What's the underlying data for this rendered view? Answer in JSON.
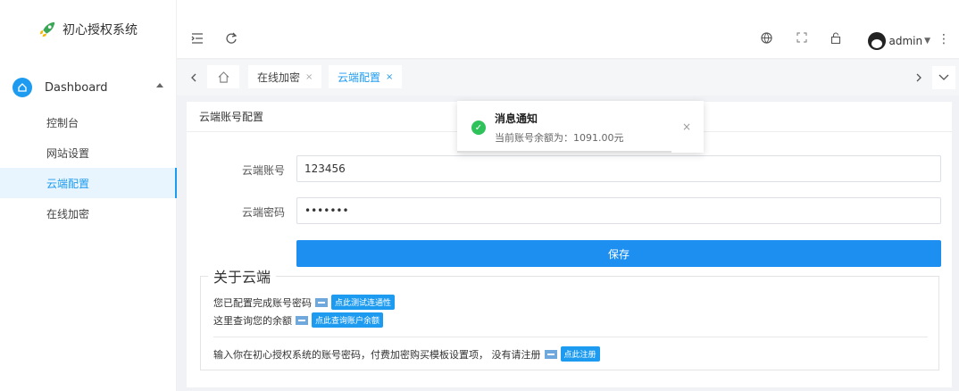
{
  "app": {
    "title": "初心授权系统"
  },
  "sidebar": {
    "parent": {
      "label": "Dashboard"
    },
    "items": [
      {
        "label": "控制台"
      },
      {
        "label": "网站设置"
      },
      {
        "label": "云端配置"
      },
      {
        "label": "在线加密"
      }
    ]
  },
  "header": {
    "username": "admin"
  },
  "tabs": [
    {
      "label": "在线加密",
      "close": "×"
    },
    {
      "label": "云端配置",
      "close": "×"
    }
  ],
  "card": {
    "title": "云端账号配置",
    "account_label": "云端账号",
    "account_value": "123456",
    "password_label": "云端密码",
    "password_value": "1234567",
    "save_label": "保存"
  },
  "about": {
    "legend": "关于云端",
    "line1_text": "您已配置完成账号密码",
    "line1_button": "点此测试连通性",
    "line2_text": "这里查询您的余额",
    "line2_button": "点此查询账户余额",
    "line3_text": "输入你在初心授权系统的账号密码，付费加密购买模板设置项， 没有请注册",
    "line3_button": "点此注册"
  },
  "toast": {
    "title": "消息通知",
    "message": "当前账号余额为：1091.00元",
    "close": "×",
    "status_color": "#2fc25b"
  },
  "colors": {
    "accent": "#1d9bf0"
  }
}
